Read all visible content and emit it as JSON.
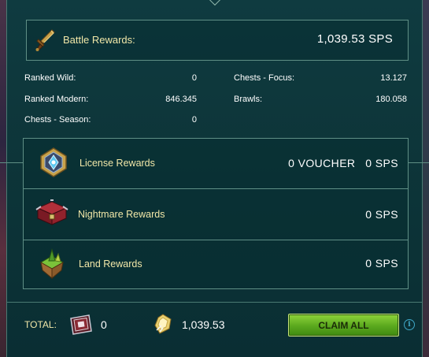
{
  "battle": {
    "label": "Battle Rewards:",
    "value": "1,039.53 SPS"
  },
  "stats": {
    "ranked_wild_label": "Ranked Wild:",
    "ranked_wild_value": "0",
    "ranked_modern_label": "Ranked Modern:",
    "ranked_modern_value": "846.345",
    "chests_season_label": "Chests - Season:",
    "chests_season_value": "0",
    "chests_focus_label": "Chests - Focus:",
    "chests_focus_value": "13.127",
    "brawls_label": "Brawls:",
    "brawls_value": "180.058"
  },
  "rewards": [
    {
      "label": "License Rewards",
      "value": "0 VOUCHER   0 SPS",
      "icon": "license-icon"
    },
    {
      "label": "Nightmare Rewards",
      "value": "0 SPS",
      "icon": "nightmare-chest-icon"
    },
    {
      "label": "Land Rewards",
      "value": "0 SPS",
      "icon": "land-icon"
    }
  ],
  "total": {
    "label": "TOTAL:",
    "vouchers": "0",
    "sps": "1,039.53"
  },
  "claim_button": "CLAIM ALL",
  "info": "i",
  "colors": {
    "panel": "#0d3539",
    "border": "#5f8f85",
    "label_gold": "#f1e7a8",
    "button_green": "#5aa81e",
    "info_blue": "#3fa8c8"
  }
}
